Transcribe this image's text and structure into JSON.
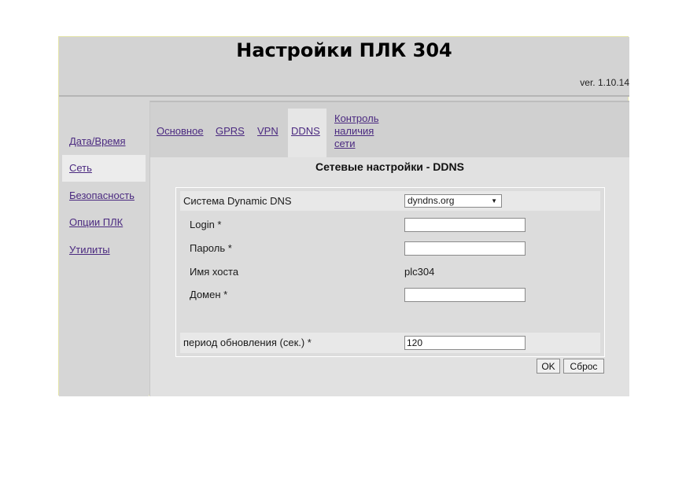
{
  "header": {
    "title": "Настройки ПЛК 304",
    "version": "ver. 1.10.14"
  },
  "sidebar": {
    "items": [
      {
        "label": "Дата/Время",
        "active": false
      },
      {
        "label": "Сеть",
        "active": true
      },
      {
        "label": "Безопасность",
        "active": false
      },
      {
        "label": "Опции ПЛК",
        "active": false
      },
      {
        "label": "Утилиты",
        "active": false
      }
    ]
  },
  "tabs": {
    "basic": "Основное",
    "gprs": "GPRS",
    "vpn": "VPN",
    "ddns": "DDNS",
    "control_line1": "Контроль",
    "control_line2": "наличия",
    "control_line3": "сети",
    "active": "DDNS"
  },
  "main": {
    "section_title": "Сетевые настройки - DDNS"
  },
  "form": {
    "ddns_system_label": "Система Dynamic DNS",
    "ddns_system_value": "dyndns.org",
    "login_label": "Login *",
    "login_value": "",
    "password_label": "Пароль *",
    "password_value": "",
    "hostname_label": "Имя хоста",
    "hostname_value": "plc304",
    "domain_label": "Домен *",
    "domain_value": "",
    "period_label": "период обновления (сек.) *",
    "period_value": "120"
  },
  "buttons": {
    "ok": "OK",
    "reset": "Сброс"
  }
}
